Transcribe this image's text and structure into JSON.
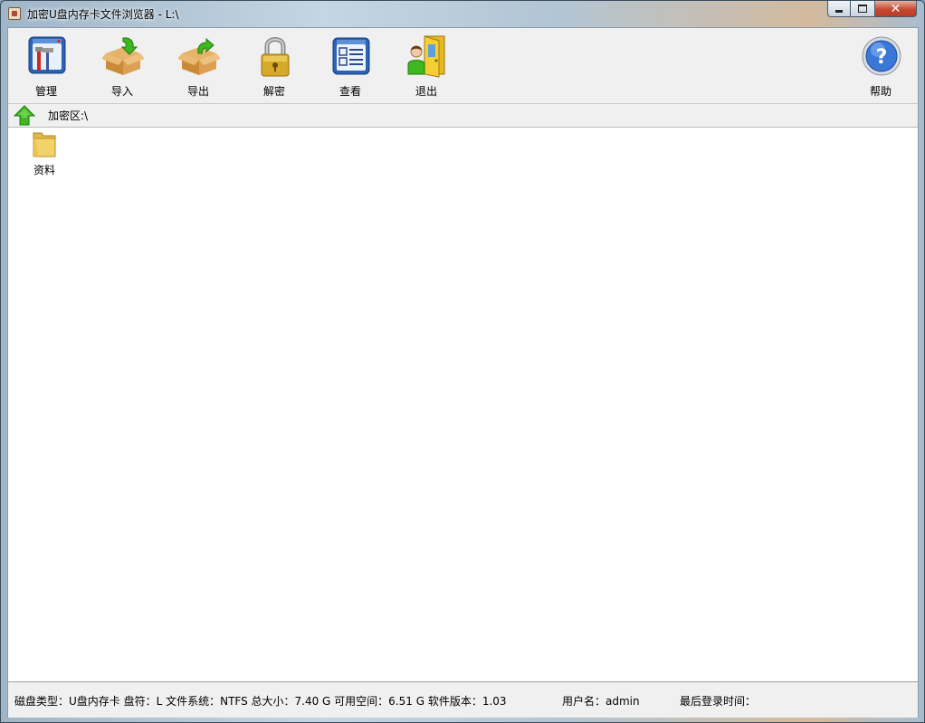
{
  "window": {
    "title": "加密U盘内存卡文件浏览器 - L:\\"
  },
  "toolbar": {
    "buttons": [
      {
        "label": "管理",
        "icon": "manage-tools-icon"
      },
      {
        "label": "导入",
        "icon": "import-box-icon"
      },
      {
        "label": "导出",
        "icon": "export-box-icon"
      },
      {
        "label": "解密",
        "icon": "padlock-icon"
      },
      {
        "label": "查看",
        "icon": "view-window-icon"
      },
      {
        "label": "退出",
        "icon": "exit-door-icon"
      }
    ],
    "help": {
      "label": "帮助",
      "icon": "help-question-icon"
    }
  },
  "address": {
    "path": "加密区:\\",
    "up_icon": "up-arrow-icon"
  },
  "files": [
    {
      "name": "资料",
      "icon": "folder-icon"
    }
  ],
  "status": {
    "disk_info": "磁盘类型：U盘内存卡  盘符：L  文件系统：NTFS  总大小：7.40 G  可用空间：6.51 G  软件版本：1.03",
    "user": "用户名：admin",
    "last_login": "最后登录时间："
  },
  "colors": {
    "accent_green": "#3fb81f",
    "folder_yellow": "#f2d36a",
    "close_red": "#c74830",
    "toolbar_bg": "#f0f0f0"
  }
}
